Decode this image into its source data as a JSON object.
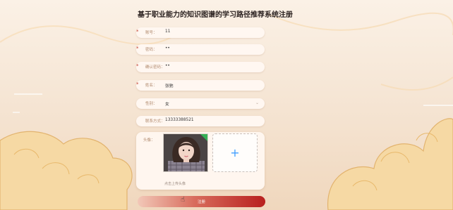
{
  "header": {
    "title": "基于职业能力的知识图谱的学习路径推荐系统注册"
  },
  "form": {
    "fields": [
      {
        "label": "账号：",
        "value": "11",
        "required": true,
        "type": "text"
      },
      {
        "label": "密码：",
        "value": "••",
        "required": true,
        "type": "password"
      },
      {
        "label": "确认密码：",
        "value": "••",
        "required": true,
        "type": "password"
      },
      {
        "label": "姓名：",
        "value": "张驰",
        "required": true,
        "type": "text"
      },
      {
        "label": "性别：",
        "value": "女",
        "required": false,
        "type": "select"
      },
      {
        "label": "联系方式：",
        "value": "13333388521",
        "required": false,
        "type": "text"
      }
    ],
    "avatar_label": "头像：",
    "upload_hint": "点击上传头像",
    "upload_icon": "plus-icon",
    "submit_label": "注册"
  },
  "colors": {
    "accent": "#409eff",
    "required": "#c0392b",
    "label": "#b0896c",
    "submit_start": "#f2c8b8",
    "submit_end": "#b8201e"
  }
}
